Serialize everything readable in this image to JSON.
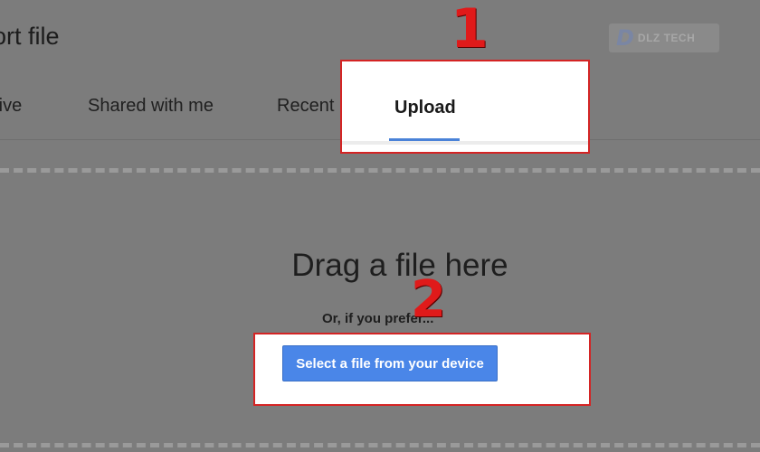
{
  "dialog": {
    "title": "ort file"
  },
  "logo": {
    "mark": "D",
    "text": "DLZ TECH"
  },
  "tabs": [
    {
      "label": "rive",
      "active": false
    },
    {
      "label": "Shared with me",
      "active": false
    },
    {
      "label": "Recent",
      "active": false
    },
    {
      "label": "Upload",
      "active": true
    }
  ],
  "upload_area": {
    "heading": "Drag a file here",
    "or_text": "Or, if you prefer...",
    "select_button": "Select a file from your device"
  },
  "annotations": [
    {
      "label": "1",
      "color": "#e01a1a"
    },
    {
      "label": "2",
      "color": "#e01a1a"
    }
  ],
  "colors": {
    "accent": "#4a86e8",
    "highlight_border": "#d42424",
    "overlay": "#7c7c7c"
  }
}
